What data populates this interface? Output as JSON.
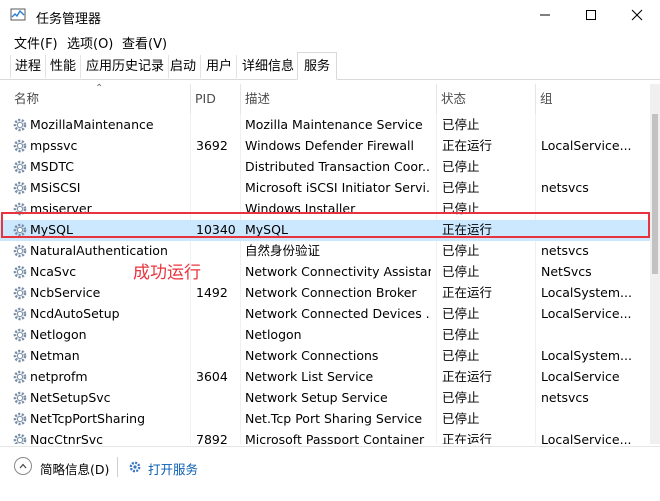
{
  "window": {
    "title": "任务管理器"
  },
  "menu": [
    "文件(F)",
    "选项(O)",
    "查看(V)"
  ],
  "tabs": [
    "进程",
    "性能",
    "应用历史记录",
    "启动",
    "用户",
    "详细信息",
    "服务"
  ],
  "active_tab": "服务",
  "columns": {
    "name": "名称",
    "pid": "PID",
    "desc": "描述",
    "status": "状态",
    "group": "组"
  },
  "services": [
    {
      "name": "MozillaMaintenance",
      "pid": "",
      "desc": "Mozilla Maintenance Service",
      "status": "已停止",
      "group": ""
    },
    {
      "name": "mpssvc",
      "pid": "3692",
      "desc": "Windows Defender Firewall",
      "status": "正在运行",
      "group": "LocalService..."
    },
    {
      "name": "MSDTC",
      "pid": "",
      "desc": "Distributed Transaction Coor...",
      "status": "已停止",
      "group": ""
    },
    {
      "name": "MSiSCSI",
      "pid": "",
      "desc": "Microsoft iSCSI Initiator Servi...",
      "status": "已停止",
      "group": "netsvcs"
    },
    {
      "name": "msiserver",
      "pid": "",
      "desc": "Windows Installer",
      "status": "已停止",
      "group": ""
    },
    {
      "name": "MySQL",
      "pid": "10340",
      "desc": "MySQL",
      "status": "正在运行",
      "group": ""
    },
    {
      "name": "NaturalAuthentication",
      "pid": "",
      "desc": "自然身份验证",
      "status": "已停止",
      "group": "netsvcs"
    },
    {
      "name": "NcaSvc",
      "pid": "",
      "desc": "Network Connectivity Assistant",
      "status": "已停止",
      "group": "NetSvcs"
    },
    {
      "name": "NcbService",
      "pid": "1492",
      "desc": "Network Connection Broker",
      "status": "正在运行",
      "group": "LocalSystem..."
    },
    {
      "name": "NcdAutoSetup",
      "pid": "",
      "desc": "Network Connected Devices ...",
      "status": "已停止",
      "group": "LocalService..."
    },
    {
      "name": "Netlogon",
      "pid": "",
      "desc": "Netlogon",
      "status": "已停止",
      "group": ""
    },
    {
      "name": "Netman",
      "pid": "",
      "desc": "Network Connections",
      "status": "已停止",
      "group": "LocalSystem..."
    },
    {
      "name": "netprofm",
      "pid": "3604",
      "desc": "Network List Service",
      "status": "正在运行",
      "group": "LocalService"
    },
    {
      "name": "NetSetupSvc",
      "pid": "",
      "desc": "Network Setup Service",
      "status": "已停止",
      "group": "netsvcs"
    },
    {
      "name": "NetTcpPortSharing",
      "pid": "",
      "desc": "Net.Tcp Port Sharing Service",
      "status": "已停止",
      "group": ""
    },
    {
      "name": "NgcCtnrSvc",
      "pid": "7892",
      "desc": "Microsoft Passport Container",
      "status": "正在运行",
      "group": "LocalService..."
    }
  ],
  "selected_service": "MySQL",
  "annotation": "成功运行",
  "footer": {
    "fewer_details": "简略信息(D)",
    "open_services": "打开服务"
  },
  "colors": {
    "highlight_border": "#e8343e",
    "selected_row": "#cce8ff",
    "link": "#0a5fb4"
  }
}
